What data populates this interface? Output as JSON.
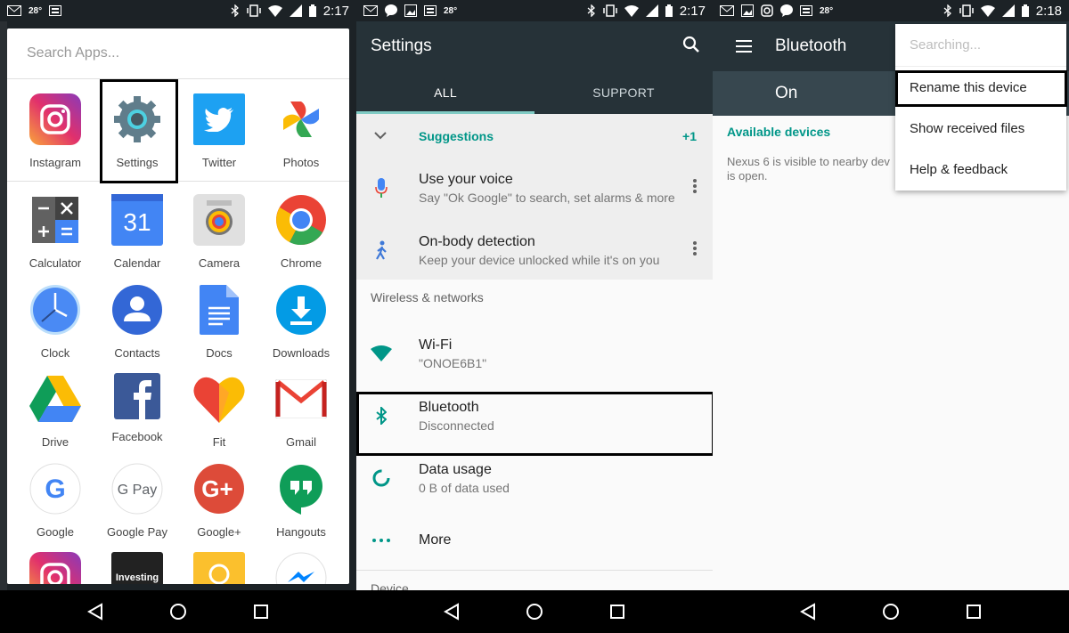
{
  "statusbar": {
    "left": {
      "temp": "28°",
      "time": "2:17"
    },
    "middle": {
      "temp": "28°",
      "time": "2:17"
    },
    "right": {
      "temp": "28°",
      "time": "2:18"
    }
  },
  "drawer": {
    "search_placeholder": "Search Apps...",
    "favorites": [
      {
        "label": "Instagram",
        "icon": "instagram-icon"
      },
      {
        "label": "Settings",
        "icon": "settings-icon"
      },
      {
        "label": "Twitter",
        "icon": "twitter-icon"
      },
      {
        "label": "Photos",
        "icon": "photos-icon"
      }
    ],
    "apps": [
      {
        "label": "Calculator",
        "icon": "calculator-icon"
      },
      {
        "label": "Calendar",
        "icon": "calendar-icon",
        "number": "31"
      },
      {
        "label": "Camera",
        "icon": "camera-icon"
      },
      {
        "label": "Chrome",
        "icon": "chrome-icon"
      },
      {
        "label": "Clock",
        "icon": "clock-icon"
      },
      {
        "label": "Contacts",
        "icon": "contacts-icon"
      },
      {
        "label": "Docs",
        "icon": "docs-icon"
      },
      {
        "label": "Downloads",
        "icon": "downloads-icon"
      },
      {
        "label": "Drive",
        "icon": "drive-icon"
      },
      {
        "label": "Facebook",
        "icon": "facebook-icon"
      },
      {
        "label": "Fit",
        "icon": "fit-icon"
      },
      {
        "label": "Gmail",
        "icon": "gmail-icon"
      },
      {
        "label": "Google",
        "icon": "google-icon"
      },
      {
        "label": "Google Pay",
        "icon": "google-pay-icon"
      },
      {
        "label": "Google+",
        "icon": "google-plus-icon"
      },
      {
        "label": "Hangouts",
        "icon": "hangouts-icon"
      },
      {
        "label": "",
        "icon": "instagram-icon"
      },
      {
        "label": "",
        "icon": "investing-icon",
        "text": "Investing"
      },
      {
        "label": "",
        "icon": "keep-icon"
      },
      {
        "label": "",
        "icon": "messenger-icon"
      }
    ]
  },
  "settings": {
    "title": "Settings",
    "tabs": [
      "ALL",
      "SUPPORT"
    ],
    "suggestions": {
      "label": "Suggestions",
      "count": "+1"
    },
    "suggestion_items": [
      {
        "title": "Use your voice",
        "subtitle": "Say \"Ok Google\" to search, set alarms & more"
      },
      {
        "title": "On-body detection",
        "subtitle": "Keep your device unlocked while it's on you"
      }
    ],
    "section_wireless": "Wireless & networks",
    "items": [
      {
        "title": "Wi-Fi",
        "subtitle": "\"ONOE6B1\""
      },
      {
        "title": "Bluetooth",
        "subtitle": "Disconnected"
      },
      {
        "title": "Data usage",
        "subtitle": "0 B of data used"
      },
      {
        "title": "More",
        "subtitle": ""
      }
    ],
    "section_device": "Device"
  },
  "bluetooth": {
    "title": "Bluetooth",
    "toggle_label": "On",
    "available": "Available devices",
    "visible_text": "Nexus 6 is visible to nearby dev... is open.",
    "visible_line1": "Nexus 6 is visible to nearby dev",
    "visible_line2": "is open.",
    "menu": {
      "search": "Searching...",
      "items": [
        "Rename this device",
        "Show received files",
        "Help & feedback"
      ]
    }
  },
  "colors": {
    "toolbar": "#263238",
    "accent": "#009688",
    "highlight": "#000000"
  }
}
